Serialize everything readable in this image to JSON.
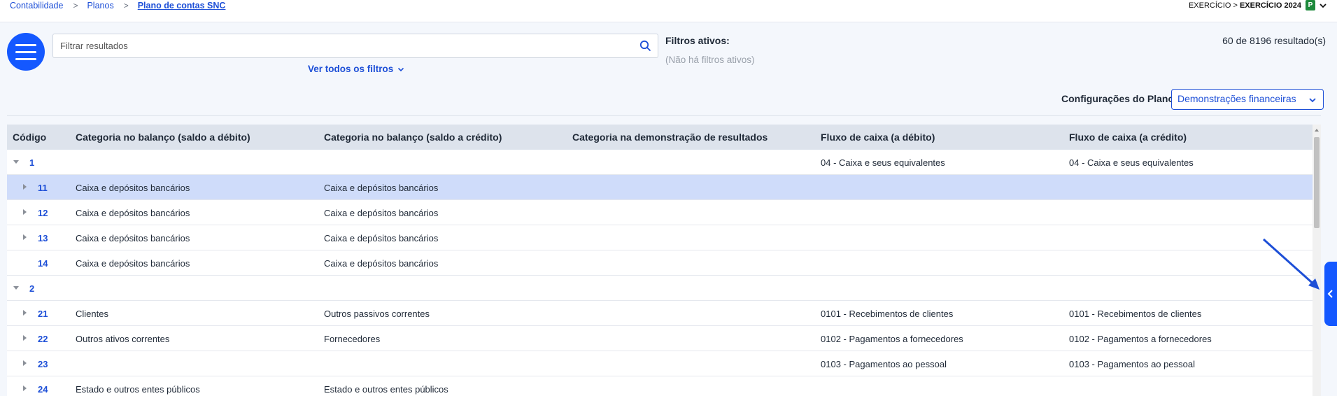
{
  "breadcrumb": {
    "items": [
      "Contabilidade",
      "Planos"
    ],
    "current": "Plano de contas SNC"
  },
  "exercise": {
    "prefix": "EXERCÍCIO >",
    "name": "EXERCÍCIO 2024",
    "badge": "P"
  },
  "search": {
    "placeholder": "Filtrar resultados"
  },
  "filters": {
    "toggle_label": "Ver todos os filtros",
    "title": "Filtros ativos:",
    "none": "(Não há filtros ativos)"
  },
  "results": {
    "text": "60 de 8196 resultado(s)"
  },
  "plan_config": {
    "label": "Configurações do Plano:",
    "selected": "Demonstrações financeiras"
  },
  "table": {
    "columns": [
      "Código",
      "Categoria no balanço (saldo a débito)",
      "Categoria no balanço (saldo a crédito)",
      "Categoria na demonstração de resultados",
      "Fluxo de caixa (a débito)",
      "Fluxo de caixa (a crédito)"
    ],
    "rows": [
      {
        "code": "1",
        "level": 0,
        "toggle": "expanded",
        "selected": false,
        "debit": "",
        "credit": "",
        "result": "",
        "cash_debit": "04 - Caixa e seus equivalentes",
        "cash_credit": "04 - Caixa e seus equivalentes"
      },
      {
        "code": "11",
        "level": 1,
        "toggle": "collapsed",
        "selected": true,
        "debit": "Caixa e depósitos bancários",
        "credit": "Caixa e depósitos bancários",
        "result": "",
        "cash_debit": "",
        "cash_credit": ""
      },
      {
        "code": "12",
        "level": 1,
        "toggle": "collapsed",
        "selected": false,
        "debit": "Caixa e depósitos bancários",
        "credit": "Caixa e depósitos bancários",
        "result": "",
        "cash_debit": "",
        "cash_credit": ""
      },
      {
        "code": "13",
        "level": 1,
        "toggle": "collapsed",
        "selected": false,
        "debit": "Caixa e depósitos bancários",
        "credit": "Caixa e depósitos bancários",
        "result": "",
        "cash_debit": "",
        "cash_credit": ""
      },
      {
        "code": "14",
        "level": 1,
        "toggle": "none",
        "selected": false,
        "debit": "Caixa e depósitos bancários",
        "credit": "Caixa e depósitos bancários",
        "result": "",
        "cash_debit": "",
        "cash_credit": ""
      },
      {
        "code": "2",
        "level": 0,
        "toggle": "expanded",
        "selected": false,
        "debit": "",
        "credit": "",
        "result": "",
        "cash_debit": "",
        "cash_credit": ""
      },
      {
        "code": "21",
        "level": 1,
        "toggle": "collapsed",
        "selected": false,
        "debit": "Clientes",
        "credit": "Outros passivos correntes",
        "result": "",
        "cash_debit": "0101 - Recebimentos de clientes",
        "cash_credit": "0101 - Recebimentos de clientes"
      },
      {
        "code": "22",
        "level": 1,
        "toggle": "collapsed",
        "selected": false,
        "debit": "Outros ativos correntes",
        "credit": "Fornecedores",
        "result": "",
        "cash_debit": "0102 - Pagamentos a fornecedores",
        "cash_credit": "0102 - Pagamentos a fornecedores"
      },
      {
        "code": "23",
        "level": 1,
        "toggle": "collapsed",
        "selected": false,
        "debit": "",
        "credit": "",
        "result": "",
        "cash_debit": "0103 - Pagamentos ao pessoal",
        "cash_credit": "0103 - Pagamentos ao pessoal"
      },
      {
        "code": "24",
        "level": 1,
        "toggle": "collapsed",
        "selected": false,
        "debit": "Estado e outros entes públicos",
        "credit": "Estado e outros entes públicos",
        "result": "",
        "cash_debit": "",
        "cash_credit": ""
      }
    ]
  },
  "icons": {
    "menu": "hamburger-icon",
    "search": "search-icon",
    "side_panel": "chevron-left-icon"
  },
  "colors": {
    "accent": "#1458ff",
    "link": "#1d4fd7",
    "selected_row": "#cfdcfa",
    "header_bg": "#dde3ec",
    "badge": "#1e8a3c"
  }
}
